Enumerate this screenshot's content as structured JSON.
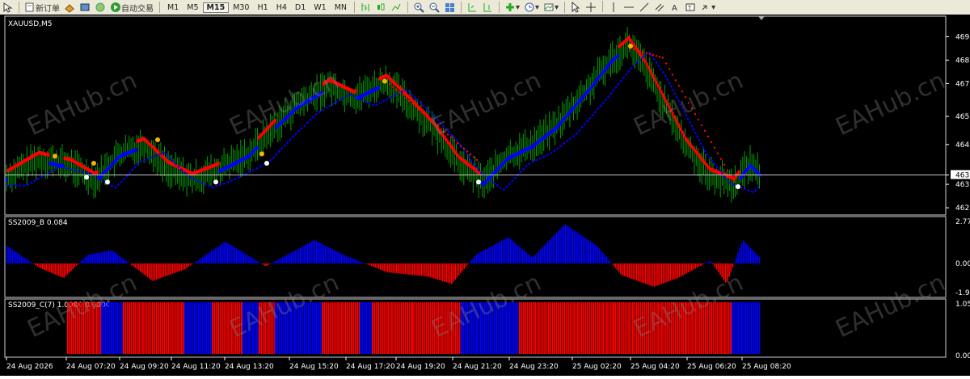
{
  "toolbar": {
    "new_order": "新订单",
    "auto_trading": "自动交易",
    "timeframes": [
      "M1",
      "M5",
      "M15",
      "M30",
      "H1",
      "H4",
      "D1",
      "W1",
      "MN"
    ],
    "active_timeframe": "M15",
    "tools": [
      "cursor-icon",
      "crosshair-icon",
      "vertical-line-icon",
      "horizontal-line-icon",
      "trendline-icon",
      "channel-icon",
      "text-tool-icon",
      "label-tool-icon",
      "arrows-icon"
    ]
  },
  "watermark": "EAHub.cn",
  "panes": {
    "main": {
      "label": "XAUUSD,M5",
      "price_levels": [
        "469",
        "468",
        "467",
        "465",
        "464",
        "463",
        "463",
        "462"
      ],
      "current_price": "463"
    },
    "ind_b": {
      "label": "SS2009_B 0.084",
      "levels": [
        "2.77",
        "0.00",
        "-1.9"
      ]
    },
    "ind_c": {
      "label": "SS2009_C(7) 1.0000 0.0000",
      "levels": [
        "1.05",
        "0.00"
      ]
    }
  },
  "time_axis": [
    "24 Aug 2026",
    "24 Aug 07:20",
    "24 Aug 09:20",
    "24 Aug 11:20",
    "24 Aug 13:20",
    "24 Aug 15:20",
    "24 Aug 17:20",
    "24 Aug 19:20",
    "24 Aug 21:20",
    "24 Aug 23:20",
    "25 Aug 02:20",
    "25 Aug 04:20",
    "25 Aug 06:20",
    "25 Aug 08:20"
  ],
  "colors": {
    "bull": "#0000ff",
    "bear": "#ff0000",
    "candle": "#00a000",
    "background": "#000000",
    "axis_text": "#ffffff",
    "watermark": "#888888"
  },
  "chart_data": {
    "type": "line",
    "series_keypoints": [
      {
        "x": 0,
        "y": 463.2
      },
      {
        "x": 40,
        "y": 464.0
      },
      {
        "x": 80,
        "y": 463.7
      },
      {
        "x": 110,
        "y": 463.1
      },
      {
        "x": 140,
        "y": 464.2
      },
      {
        "x": 170,
        "y": 464.6
      },
      {
        "x": 200,
        "y": 463.6
      },
      {
        "x": 230,
        "y": 463.1
      },
      {
        "x": 260,
        "y": 463.5
      },
      {
        "x": 300,
        "y": 464.2
      },
      {
        "x": 330,
        "y": 465.3
      },
      {
        "x": 360,
        "y": 466.3
      },
      {
        "x": 400,
        "y": 467.1
      },
      {
        "x": 430,
        "y": 466.6
      },
      {
        "x": 470,
        "y": 467.3
      },
      {
        "x": 500,
        "y": 466.3
      },
      {
        "x": 530,
        "y": 465.2
      },
      {
        "x": 560,
        "y": 463.8
      },
      {
        "x": 590,
        "y": 463.0
      },
      {
        "x": 620,
        "y": 464.1
      },
      {
        "x": 650,
        "y": 464.6
      },
      {
        "x": 680,
        "y": 465.4
      },
      {
        "x": 720,
        "y": 467.0
      },
      {
        "x": 750,
        "y": 468.3
      },
      {
        "x": 770,
        "y": 468.9
      },
      {
        "x": 790,
        "y": 467.9
      },
      {
        "x": 810,
        "y": 466.6
      },
      {
        "x": 840,
        "y": 464.6
      },
      {
        "x": 870,
        "y": 463.3
      },
      {
        "x": 900,
        "y": 462.9
      },
      {
        "x": 920,
        "y": 463.8
      },
      {
        "x": 935,
        "y": 463.3
      }
    ],
    "ylim": [
      461.8,
      469.8
    ],
    "ind_b_keypoints": [
      {
        "x": 0,
        "y": 1.2
      },
      {
        "x": 40,
        "y": -0.3
      },
      {
        "x": 70,
        "y": -1.0
      },
      {
        "x": 100,
        "y": 0.6
      },
      {
        "x": 130,
        "y": 0.9
      },
      {
        "x": 180,
        "y": -1.2
      },
      {
        "x": 220,
        "y": -0.4
      },
      {
        "x": 270,
        "y": 1.5
      },
      {
        "x": 320,
        "y": -0.2
      },
      {
        "x": 380,
        "y": 1.6
      },
      {
        "x": 420,
        "y": 0.5
      },
      {
        "x": 470,
        "y": -0.6
      },
      {
        "x": 520,
        "y": -0.9
      },
      {
        "x": 550,
        "y": -1.4
      },
      {
        "x": 580,
        "y": 0.6
      },
      {
        "x": 620,
        "y": 1.8
      },
      {
        "x": 650,
        "y": 0.4
      },
      {
        "x": 690,
        "y": 2.7
      },
      {
        "x": 730,
        "y": 1.2
      },
      {
        "x": 760,
        "y": -0.8
      },
      {
        "x": 800,
        "y": -1.6
      },
      {
        "x": 830,
        "y": -1.0
      },
      {
        "x": 870,
        "y": 0.2
      },
      {
        "x": 890,
        "y": -1.4
      },
      {
        "x": 910,
        "y": 1.6
      },
      {
        "x": 935,
        "y": 0.2
      }
    ],
    "ind_b_ylim": [
      -1.9,
      2.77
    ],
    "ind_c_segments": [
      {
        "x0": 83,
        "x1": 125,
        "state": "red"
      },
      {
        "x0": 125,
        "x1": 152,
        "state": "blue"
      },
      {
        "x0": 152,
        "x1": 228,
        "state": "red"
      },
      {
        "x0": 228,
        "x1": 262,
        "state": "blue"
      },
      {
        "x0": 262,
        "x1": 300,
        "state": "red"
      },
      {
        "x0": 300,
        "x1": 320,
        "state": "blue"
      },
      {
        "x0": 320,
        "x1": 340,
        "state": "red"
      },
      {
        "x0": 340,
        "x1": 398,
        "state": "blue"
      },
      {
        "x0": 398,
        "x1": 445,
        "state": "red"
      },
      {
        "x0": 445,
        "x1": 460,
        "state": "blue"
      },
      {
        "x0": 460,
        "x1": 510,
        "state": "red"
      },
      {
        "x0": 510,
        "x1": 570,
        "state": "red"
      },
      {
        "x0": 570,
        "x1": 642,
        "state": "blue"
      },
      {
        "x0": 642,
        "x1": 758,
        "state": "red"
      },
      {
        "x0": 758,
        "x1": 848,
        "state": "red"
      },
      {
        "x0": 848,
        "x1": 905,
        "state": "red"
      },
      {
        "x0": 905,
        "x1": 940,
        "state": "blue"
      }
    ]
  }
}
